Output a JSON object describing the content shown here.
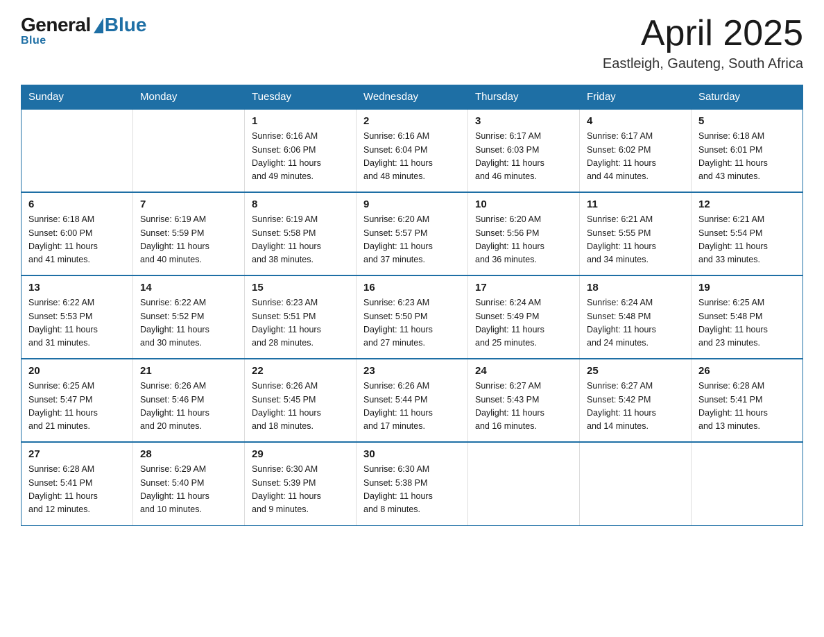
{
  "header": {
    "logo": {
      "general": "General",
      "blue": "Blue",
      "underline": "Blue"
    },
    "title": "April 2025",
    "location": "Eastleigh, Gauteng, South Africa"
  },
  "days_of_week": [
    "Sunday",
    "Monday",
    "Tuesday",
    "Wednesday",
    "Thursday",
    "Friday",
    "Saturday"
  ],
  "weeks": [
    [
      {
        "day": "",
        "info": ""
      },
      {
        "day": "",
        "info": ""
      },
      {
        "day": "1",
        "info": "Sunrise: 6:16 AM\nSunset: 6:06 PM\nDaylight: 11 hours\nand 49 minutes."
      },
      {
        "day": "2",
        "info": "Sunrise: 6:16 AM\nSunset: 6:04 PM\nDaylight: 11 hours\nand 48 minutes."
      },
      {
        "day": "3",
        "info": "Sunrise: 6:17 AM\nSunset: 6:03 PM\nDaylight: 11 hours\nand 46 minutes."
      },
      {
        "day": "4",
        "info": "Sunrise: 6:17 AM\nSunset: 6:02 PM\nDaylight: 11 hours\nand 44 minutes."
      },
      {
        "day": "5",
        "info": "Sunrise: 6:18 AM\nSunset: 6:01 PM\nDaylight: 11 hours\nand 43 minutes."
      }
    ],
    [
      {
        "day": "6",
        "info": "Sunrise: 6:18 AM\nSunset: 6:00 PM\nDaylight: 11 hours\nand 41 minutes."
      },
      {
        "day": "7",
        "info": "Sunrise: 6:19 AM\nSunset: 5:59 PM\nDaylight: 11 hours\nand 40 minutes."
      },
      {
        "day": "8",
        "info": "Sunrise: 6:19 AM\nSunset: 5:58 PM\nDaylight: 11 hours\nand 38 minutes."
      },
      {
        "day": "9",
        "info": "Sunrise: 6:20 AM\nSunset: 5:57 PM\nDaylight: 11 hours\nand 37 minutes."
      },
      {
        "day": "10",
        "info": "Sunrise: 6:20 AM\nSunset: 5:56 PM\nDaylight: 11 hours\nand 36 minutes."
      },
      {
        "day": "11",
        "info": "Sunrise: 6:21 AM\nSunset: 5:55 PM\nDaylight: 11 hours\nand 34 minutes."
      },
      {
        "day": "12",
        "info": "Sunrise: 6:21 AM\nSunset: 5:54 PM\nDaylight: 11 hours\nand 33 minutes."
      }
    ],
    [
      {
        "day": "13",
        "info": "Sunrise: 6:22 AM\nSunset: 5:53 PM\nDaylight: 11 hours\nand 31 minutes."
      },
      {
        "day": "14",
        "info": "Sunrise: 6:22 AM\nSunset: 5:52 PM\nDaylight: 11 hours\nand 30 minutes."
      },
      {
        "day": "15",
        "info": "Sunrise: 6:23 AM\nSunset: 5:51 PM\nDaylight: 11 hours\nand 28 minutes."
      },
      {
        "day": "16",
        "info": "Sunrise: 6:23 AM\nSunset: 5:50 PM\nDaylight: 11 hours\nand 27 minutes."
      },
      {
        "day": "17",
        "info": "Sunrise: 6:24 AM\nSunset: 5:49 PM\nDaylight: 11 hours\nand 25 minutes."
      },
      {
        "day": "18",
        "info": "Sunrise: 6:24 AM\nSunset: 5:48 PM\nDaylight: 11 hours\nand 24 minutes."
      },
      {
        "day": "19",
        "info": "Sunrise: 6:25 AM\nSunset: 5:48 PM\nDaylight: 11 hours\nand 23 minutes."
      }
    ],
    [
      {
        "day": "20",
        "info": "Sunrise: 6:25 AM\nSunset: 5:47 PM\nDaylight: 11 hours\nand 21 minutes."
      },
      {
        "day": "21",
        "info": "Sunrise: 6:26 AM\nSunset: 5:46 PM\nDaylight: 11 hours\nand 20 minutes."
      },
      {
        "day": "22",
        "info": "Sunrise: 6:26 AM\nSunset: 5:45 PM\nDaylight: 11 hours\nand 18 minutes."
      },
      {
        "day": "23",
        "info": "Sunrise: 6:26 AM\nSunset: 5:44 PM\nDaylight: 11 hours\nand 17 minutes."
      },
      {
        "day": "24",
        "info": "Sunrise: 6:27 AM\nSunset: 5:43 PM\nDaylight: 11 hours\nand 16 minutes."
      },
      {
        "day": "25",
        "info": "Sunrise: 6:27 AM\nSunset: 5:42 PM\nDaylight: 11 hours\nand 14 minutes."
      },
      {
        "day": "26",
        "info": "Sunrise: 6:28 AM\nSunset: 5:41 PM\nDaylight: 11 hours\nand 13 minutes."
      }
    ],
    [
      {
        "day": "27",
        "info": "Sunrise: 6:28 AM\nSunset: 5:41 PM\nDaylight: 11 hours\nand 12 minutes."
      },
      {
        "day": "28",
        "info": "Sunrise: 6:29 AM\nSunset: 5:40 PM\nDaylight: 11 hours\nand 10 minutes."
      },
      {
        "day": "29",
        "info": "Sunrise: 6:30 AM\nSunset: 5:39 PM\nDaylight: 11 hours\nand 9 minutes."
      },
      {
        "day": "30",
        "info": "Sunrise: 6:30 AM\nSunset: 5:38 PM\nDaylight: 11 hours\nand 8 minutes."
      },
      {
        "day": "",
        "info": ""
      },
      {
        "day": "",
        "info": ""
      },
      {
        "day": "",
        "info": ""
      }
    ]
  ]
}
